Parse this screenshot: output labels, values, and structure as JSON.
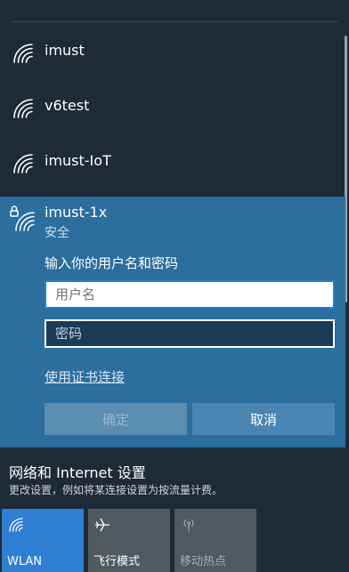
{
  "networks": [
    {
      "name": "imust"
    },
    {
      "name": "v6test"
    },
    {
      "name": "imust-IoT"
    }
  ],
  "expanded_network": {
    "name": "imust-1x",
    "security": "安全",
    "prompt": "输入你的用户名和密码",
    "username_placeholder": "用户名",
    "password_placeholder": "密码",
    "cert_link": "使用证书连接",
    "ok_label": "确定",
    "cancel_label": "取消"
  },
  "settings": {
    "title": "网络和 Internet 设置",
    "subtitle": "更改设置，例如将某连接设置为按流量计费。"
  },
  "quick_actions": [
    {
      "label": "WLAN",
      "icon": "wifi-icon",
      "active": true
    },
    {
      "label": "飞行模式",
      "icon": "airplane-icon",
      "active": false
    },
    {
      "label": "移动热点",
      "icon": "hotspot-icon",
      "active": false
    }
  ],
  "colors": {
    "panel_bg": "#1e2a35",
    "expanded_bg": "#2c6e9e",
    "accent": "#2f7fd2"
  }
}
